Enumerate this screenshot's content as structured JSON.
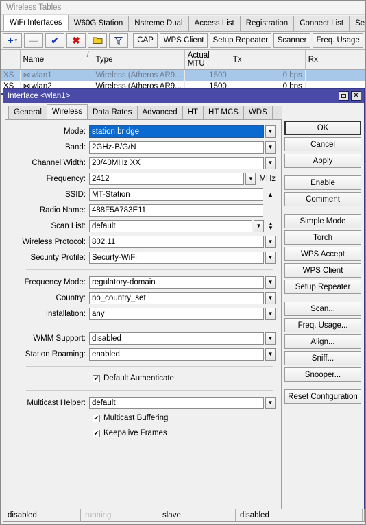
{
  "window": {
    "title": "Wireless Tables"
  },
  "top_tabs": [
    {
      "label": "WiFi Interfaces",
      "active": true
    },
    {
      "label": "W60G Station",
      "active": false
    },
    {
      "label": "Nstreme Dual",
      "active": false
    },
    {
      "label": "Access List",
      "active": false
    },
    {
      "label": "Registration",
      "active": false
    },
    {
      "label": "Connect List",
      "active": false
    },
    {
      "label": "Security Profile",
      "active": false
    }
  ],
  "toolbar": {
    "add_icon": "plus-icon",
    "add_caret": "▾",
    "remove_icon": "minus-icon",
    "enable_icon": "check-icon",
    "disable_icon": "x-icon",
    "comment_icon": "folder-icon",
    "filter_icon": "funnel-icon",
    "cap_label": "CAP",
    "wps_client_label": "WPS Client",
    "setup_repeater_label": "Setup Repeater",
    "scanner_label": "Scanner",
    "freq_usage_label": "Freq. Usage"
  },
  "table": {
    "columns": [
      "",
      "Name",
      "Type",
      "Actual MTU",
      "Tx",
      "Rx"
    ],
    "rows": [
      {
        "flags": "XS",
        "name": "wlan1",
        "type": "Wireless (Atheros AR9...",
        "mtu": "1500",
        "tx": "0 bps",
        "rx": "",
        "selected": true
      },
      {
        "flags": "XS",
        "name": "wlan2",
        "type": "Wireless (Atheros AR9...",
        "mtu": "1500",
        "tx": "0 bps",
        "rx": "",
        "selected": false
      }
    ]
  },
  "dialog": {
    "title": "Interface <wlan1>",
    "restore_icon": "restore-icon",
    "close_icon": "close-icon",
    "tabs": [
      {
        "label": "General",
        "active": false
      },
      {
        "label": "Wireless",
        "active": true
      },
      {
        "label": "Data Rates",
        "active": false
      },
      {
        "label": "Advanced",
        "active": false
      },
      {
        "label": "HT",
        "active": false
      },
      {
        "label": "HT MCS",
        "active": false
      },
      {
        "label": "WDS",
        "active": false
      },
      {
        "label": "...",
        "active": false
      }
    ],
    "fields": {
      "mode": {
        "label": "Mode:",
        "value": "station bridge",
        "selected": true
      },
      "band": {
        "label": "Band:",
        "value": "2GHz-B/G/N"
      },
      "channel_width": {
        "label": "Channel Width:",
        "value": "20/40MHz XX"
      },
      "frequency": {
        "label": "Frequency:",
        "value": "2412",
        "unit": "MHz"
      },
      "ssid": {
        "label": "SSID:",
        "value": "MT-Station"
      },
      "radio_name": {
        "label": "Radio Name:",
        "value": "488F5A783E11"
      },
      "scan_list": {
        "label": "Scan List:",
        "value": "default"
      },
      "wireless_protocol": {
        "label": "Wireless Protocol:",
        "value": "802.11"
      },
      "security_profile": {
        "label": "Security Profile:",
        "value": "Securty-WiFi"
      },
      "frequency_mode": {
        "label": "Frequency Mode:",
        "value": "regulatory-domain"
      },
      "country": {
        "label": "Country:",
        "value": "no_country_set"
      },
      "installation": {
        "label": "Installation:",
        "value": "any"
      },
      "wmm_support": {
        "label": "WMM Support:",
        "value": "disabled"
      },
      "station_roaming": {
        "label": "Station Roaming:",
        "value": "enabled"
      },
      "multicast_helper": {
        "label": "Multicast Helper:",
        "value": "default"
      }
    },
    "checkboxes": {
      "default_authenticate": {
        "label": "Default Authenticate",
        "checked": true,
        "mark": "✔"
      },
      "multicast_buffering": {
        "label": "Multicast Buffering",
        "checked": true,
        "mark": "✔"
      },
      "keepalive_frames": {
        "label": "Keepalive Frames",
        "checked": true,
        "mark": "✔"
      }
    },
    "actions": [
      {
        "label": "OK",
        "default": true,
        "gap": false
      },
      {
        "label": "Cancel",
        "default": false,
        "gap": false
      },
      {
        "label": "Apply",
        "default": false,
        "gap": false
      },
      {
        "label": "Enable",
        "default": false,
        "gap": true
      },
      {
        "label": "Comment",
        "default": false,
        "gap": false
      },
      {
        "label": "Simple Mode",
        "default": false,
        "gap": true
      },
      {
        "label": "Torch",
        "default": false,
        "gap": false
      },
      {
        "label": "WPS Accept",
        "default": false,
        "gap": false
      },
      {
        "label": "WPS Client",
        "default": false,
        "gap": false
      },
      {
        "label": "Setup Repeater",
        "default": false,
        "gap": false
      },
      {
        "label": "Scan...",
        "default": false,
        "gap": true
      },
      {
        "label": "Freq. Usage...",
        "default": false,
        "gap": false
      },
      {
        "label": "Align...",
        "default": false,
        "gap": false
      },
      {
        "label": "Sniff...",
        "default": false,
        "gap": false
      },
      {
        "label": "Snooper...",
        "default": false,
        "gap": false
      },
      {
        "label": "Reset Configuration",
        "default": false,
        "gap": true
      }
    ]
  },
  "statusbar": [
    {
      "text": "disabled",
      "dim": false
    },
    {
      "text": "running",
      "dim": true
    },
    {
      "text": "slave",
      "dim": false
    },
    {
      "text": "disabled",
      "dim": false
    },
    {
      "text": "",
      "dim": false
    }
  ],
  "colors": {
    "dialog_title": "#4a4aa8",
    "selection": "#a8c8ea",
    "field_selection": "#0b6ad0",
    "window_bg": "#f0f0f0"
  }
}
